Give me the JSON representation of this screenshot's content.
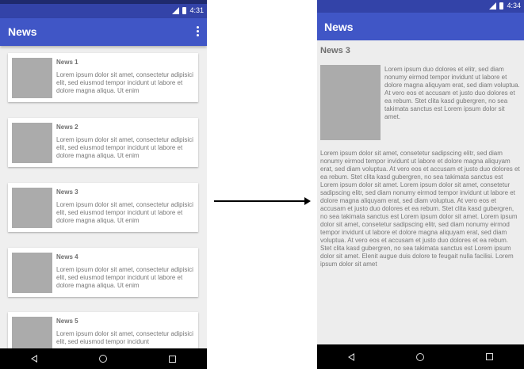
{
  "left_screen": {
    "status_time": "4:31",
    "app_title": "News",
    "menu_icon": "overflow-menu-icon",
    "items": [
      {
        "title": "News 1",
        "body": "Lorem ipsum dolor sit amet, consectetur adipisici elit, sed eiusmod tempor incidunt ut labore et dolore magna aliqua. Ut enim"
      },
      {
        "title": "News 2",
        "body": "Lorem ipsum dolor sit amet, consectetur adipisici elit, sed eiusmod tempor incidunt ut labore et dolore magna aliqua. Ut enim"
      },
      {
        "title": "News 3",
        "body": "Lorem ipsum dolor sit amet, consectetur adipisici elit, sed eiusmod tempor incidunt ut labore et dolore magna aliqua. Ut enim"
      },
      {
        "title": "News 4",
        "body": "Lorem ipsum dolor sit amet, consectetur adipisici elit, sed eiusmod tempor incidunt ut labore et dolore magna aliqua. Ut enim"
      },
      {
        "title": "News 5",
        "body": "Lorem ipsum dolor sit amet, consectetur adipisici elit, sed eiusmod tempor incidunt"
      }
    ]
  },
  "right_screen": {
    "status_time": "4:34",
    "app_title": "News",
    "detail_title": "News 3",
    "intro": "Lorem ipsum duo dolores et elitr, sed diam nonumy eirmod tempor invidunt ut labore et dolore magna aliquyam erat, sed diam voluptua. At vero eos et accusam et justo duo dolores et ea rebum. Stet clita kasd gubergren, no sea takimata sanctus est Lorem ipsum dolor sit amet.",
    "body": "Lorem ipsum dolor sit amet, consetetur sadipscing elitr, sed diam nonumy eirmod tempor invidunt ut labore et dolore magna aliquyam erat, sed diam voluptua. At vero eos et accusam et justo duo dolores et ea rebum. Stet clita kasd gubergren, no sea takimata sanctus est Lorem ipsum dolor sit amet. Lorem ipsum dolor sit amet, consetetur sadipscing elitr, sed diam nonumy eirmod tempor invidunt ut labore et dolore magna aliquyam erat, sed diam voluptua. At vero eos et accusam et justo duo dolores et ea rebum. Stet clita kasd gubergren, no sea takimata sanctus est Lorem ipsum dolor sit amet. Lorem ipsum dolor sit amet, consetetur sadipscing elitr, sed diam nonumy eirmod tempor invidunt ut labore et dolore magna aliquyam erat, sed diam voluptua. At vero eos et accusam et justo duo dolores et ea rebum. Stet clita kasd gubergren, no sea takimata sanctus est Lorem ipsum dolor sit amet. Elenit augue duis dolore te feugait nulla facilisi. Lorem ipsum dolor sit amet"
  },
  "colors": {
    "app_bar": "#4056c6",
    "status_bar": "#3343a8",
    "thumbnail": "#ababab"
  }
}
